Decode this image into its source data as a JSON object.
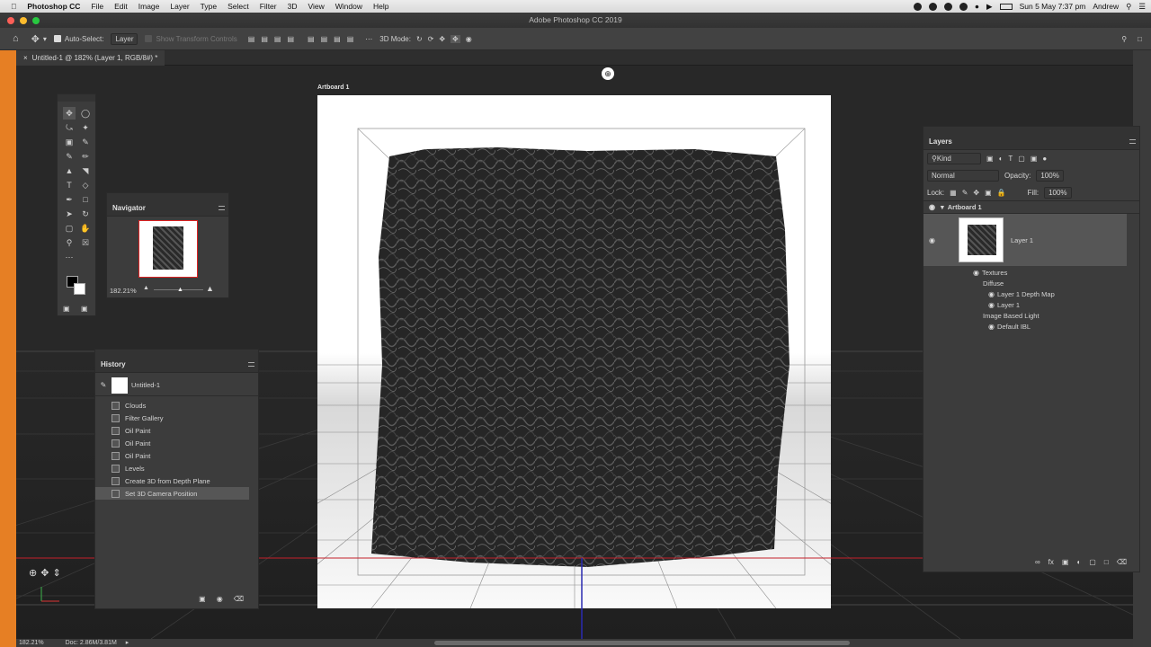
{
  "menubar": {
    "items": [
      "Photoshop CC",
      "File",
      "Edit",
      "Image",
      "Layer",
      "Type",
      "Select",
      "Filter",
      "3D",
      "View",
      "Window",
      "Help"
    ],
    "datetime": "Sun 5 May  7:37 pm",
    "user": "Andrew"
  },
  "window": {
    "title": "Adobe Photoshop CC 2019"
  },
  "options": {
    "auto_select_label": "Auto-Select:",
    "auto_select_value": "Layer",
    "show_transform": "Show Transform Controls",
    "mode_3d": "3D Mode:"
  },
  "doc_tab": {
    "label": "Untitled-1 @ 182% (Layer 1, RGB/8#) *"
  },
  "artboard": {
    "label": "Artboard 1"
  },
  "navigator": {
    "title": "Navigator",
    "zoom": "182.21%"
  },
  "history": {
    "title": "History",
    "snapshot": "Untitled-1",
    "items": [
      "Clouds",
      "Filter Gallery",
      "Oil Paint",
      "Oil Paint",
      "Oil Paint",
      "Levels",
      "Create 3D from Depth Plane",
      "Set 3D Camera Position"
    ]
  },
  "layers": {
    "title": "Layers",
    "kind": "Kind",
    "blend": "Normal",
    "opacity_label": "Opacity:",
    "opacity": "100%",
    "lock_label": "Lock:",
    "fill_label": "Fill:",
    "fill": "100%",
    "artboard": "Artboard 1",
    "layer": "Layer 1",
    "sub": [
      "Textures",
      "Diffuse",
      "Layer 1 Depth Map",
      "Layer 1",
      "Image Based Light",
      "Default IBL"
    ]
  },
  "status": {
    "zoom": "182.21%",
    "doc": "Doc: 2.86M/3.81M"
  },
  "colors": {
    "accent_orange": "#e67f24",
    "selected_row": "#565656"
  }
}
